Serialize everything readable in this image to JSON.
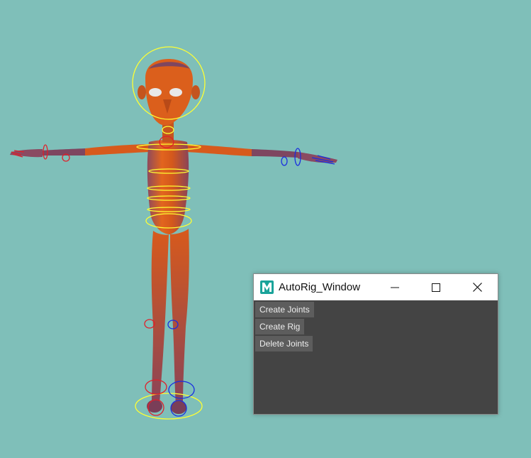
{
  "window": {
    "title": "AutoRig_Window",
    "icon": "maya-icon",
    "controls": [
      "minimize-icon",
      "maximize-icon",
      "close-icon"
    ]
  },
  "buttons": {
    "create_joints": "Create Joints",
    "create_rig": "Create Rig",
    "delete_joints": "Delete Joints"
  },
  "colors": {
    "viewport_bg": "#7fbfb9",
    "skin": "#d4581c",
    "rig_controls_center": "#ffff33",
    "rig_controls_left": "#e0202a",
    "rig_controls_right": "#1a2ee0",
    "panel_bg": "#444444",
    "button_bg": "#5d5d5d"
  }
}
